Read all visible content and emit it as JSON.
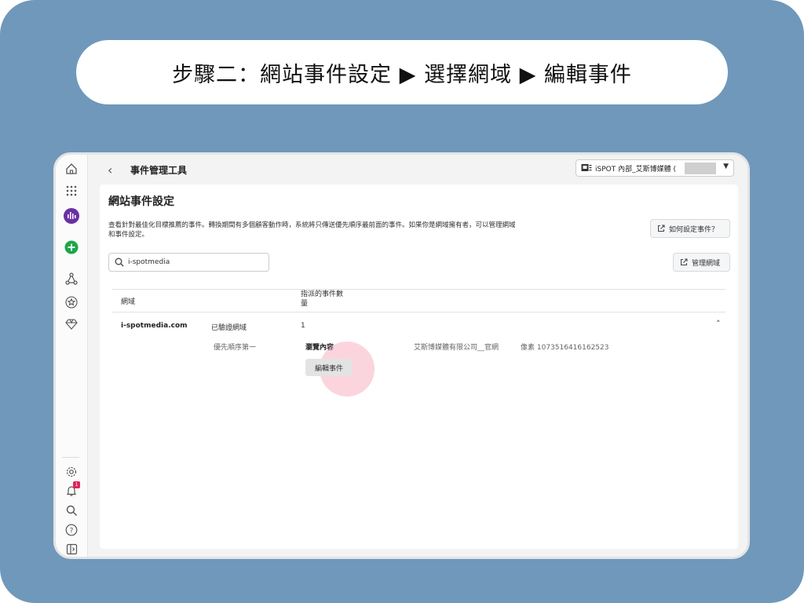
{
  "banner": {
    "text": "步驟二：網站事件設定 ▶ 選擇網域 ▶ 編輯事件"
  },
  "topbar": {
    "app_name": "事件管理工具",
    "account": "iSPOT 內部_艾斯博媒體 ("
  },
  "sidebar": {
    "notification_count": "1"
  },
  "panel": {
    "title": "網站事件設定",
    "description": "查看針對最佳化目標推薦的事件。轉換期間有多個顧客動作時，系統將只傳送優先順序最前面的事件。如果你是網域擁有者，可以管理網域和事件設定。",
    "how_to_button": "如何設定事件？",
    "manage_domains_button": "管理網域",
    "search_value": "i-spotmedia"
  },
  "table": {
    "col_domain": "網域",
    "col_events": "指派的事件數量",
    "row": {
      "domain": "i-spotmedia.com",
      "status": "已驗證網域",
      "count": "1",
      "priority": "優先順序第一",
      "event": "瀏覽內容",
      "company": "艾斯博媒體有限公司__官網",
      "pixel": "像素 1073516416162523",
      "edit_button": "編輯事件"
    }
  },
  "colors": {
    "background": "#6f98bb",
    "accent_purple": "#6b2fa3",
    "accent_green": "#1aa84a",
    "badge_red": "#e0245e"
  }
}
